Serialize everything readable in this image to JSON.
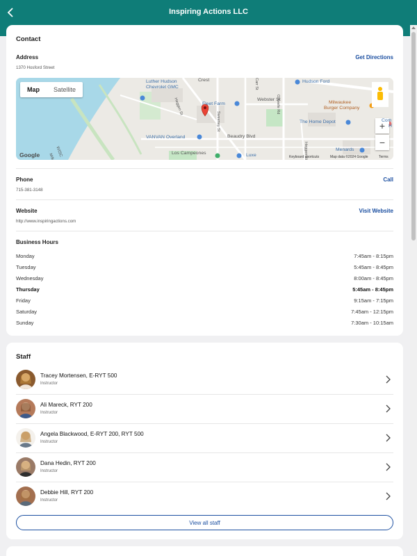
{
  "header": {
    "title": "Inspiring Actions LLC"
  },
  "contact": {
    "title": "Contact",
    "address_label": "Address",
    "address": "1370 Hosford Street",
    "directions": "Get Directions",
    "phone_label": "Phone",
    "phone": "715-381-3148",
    "call": "Call",
    "website_label": "Website",
    "website": "http://www.inspiringactions.com",
    "visit": "Visit Website",
    "hours_title": "Business Hours",
    "hours": [
      {
        "day": "Monday",
        "time": "7:45am - 8:15pm"
      },
      {
        "day": "Tuesday",
        "time": "5:45am - 8:45pm"
      },
      {
        "day": "Wednesday",
        "time": "8:00am - 8:45pm"
      },
      {
        "day": "Thursday",
        "time": "5:45am - 8:45pm"
      },
      {
        "day": "Friday",
        "time": "9:15am - 7:15pm"
      },
      {
        "day": "Saturday",
        "time": "7:45am - 12:15pm"
      },
      {
        "day": "Sunday",
        "time": "7:30am - 10:15am"
      }
    ]
  },
  "map": {
    "type_map": "Map",
    "type_satellite": "Satellite",
    "zoom_in": "+",
    "zoom_out": "−",
    "labels": {
      "luther": "Luther Hudson",
      "luther2": "Chevrolet GMC",
      "fleet": "Fleet Farm",
      "hudson_ford": "Hudson Ford",
      "webster": "Webster St",
      "milwaukee": "Milwaukee",
      "milwaukee2": "Burger Company",
      "home_depot": "The Home Depot",
      "vanvan": "VANVAN Overland",
      "beaudry": "Beaudry Blvd",
      "campeones": "Los Campeones",
      "luxe": "Luxe",
      "menards": "Menards",
      "comm": "Com",
      "comm2": "H",
      "crest": "Crest",
      "okeefe": "O'Keefe Rd",
      "heggen": "Heggen St",
      "sweeney": "Sweeney St",
      "carr": "Carr St",
      "heggen2": "Heggen St",
      "wisc": "WISC",
      "milk": "Milk"
    },
    "google": "Google",
    "shortcuts": "Keyboard shortcuts",
    "map_data": "Map data ©2024 Google",
    "terms": "Terms"
  },
  "staff": {
    "title": "Staff",
    "members": [
      {
        "name": "Tracey Mortensen, E-RYT 500",
        "role": "Instructor"
      },
      {
        "name": "Ali Mareck, RYT 200",
        "role": "Instructor"
      },
      {
        "name": "Angela Blackwood, E-RYT 200, RYT 500",
        "role": "Instructor"
      },
      {
        "name": "Dana Hedin, RYT 200",
        "role": "Instructor"
      },
      {
        "name": "Debbie Hill, RYT 200",
        "role": "Instructor"
      }
    ],
    "view_all": "View all staff"
  },
  "colors": {
    "header": "#0f7d78",
    "link": "#1a4ea0",
    "background": "#f0f0f2"
  }
}
